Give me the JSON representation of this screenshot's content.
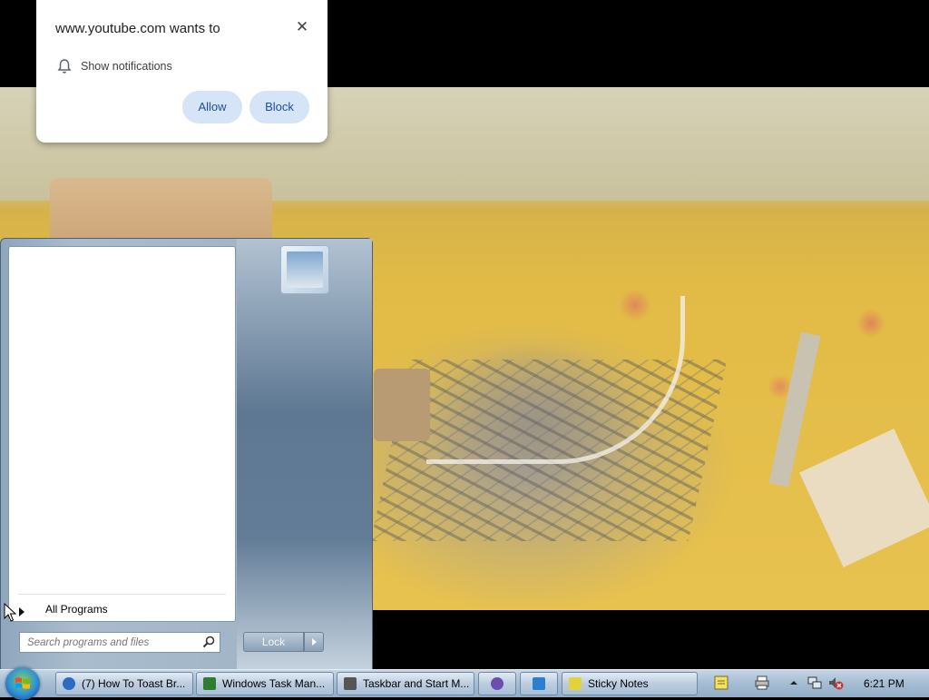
{
  "notification": {
    "title": "www.youtube.com wants to",
    "message": "Show notifications",
    "allow_label": "Allow",
    "block_label": "Block",
    "close_glyph": "✕",
    "icon": "bell-icon"
  },
  "start_menu": {
    "all_programs_label": "All Programs",
    "search_placeholder": "Search programs and files",
    "lock_label": "Lock",
    "user_tile_icon": "user-picture"
  },
  "taskbar": {
    "tasks": [
      {
        "label": "(7) How To Toast Br...",
        "icon": "chrome-icon",
        "color": "#2b6bc4"
      },
      {
        "label": "Windows Task Man...",
        "icon": "task-manager-icon",
        "color": "#2e7d32"
      },
      {
        "label": "Taskbar and Start M...",
        "icon": "taskbar-properties-icon",
        "color": "#555555"
      },
      {
        "label": "",
        "icon": "media-icon",
        "color": "#6a4fb0"
      },
      {
        "label": "",
        "icon": "bird-icon",
        "color": "#2a7fd0"
      },
      {
        "label": "Sticky Notes",
        "icon": "sticky-notes-icon",
        "color": "#e3d33b"
      }
    ],
    "tray_icons": [
      "notes-icon",
      "printer-icon",
      "show-hidden-icon",
      "network-icon",
      "volume-muted-icon"
    ],
    "clock": "6:21 PM"
  }
}
